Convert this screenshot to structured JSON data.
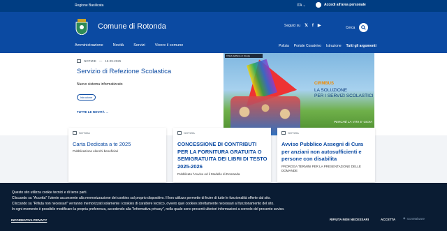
{
  "topbar": {
    "region": "Regione Basilicata",
    "language": "ITA",
    "login": "Accedi all'area personale"
  },
  "header": {
    "title": "Comune di Rotonda",
    "follow": "Seguici su",
    "social": [
      "twitter-icon",
      "facebook-icon",
      "youtube-icon"
    ],
    "search": "Cerca"
  },
  "nav": {
    "main": [
      "Amministrazione",
      "Novità",
      "Servizi",
      "Vivere il comune"
    ],
    "secondary": [
      "Polizia",
      "Portale Cosatvivo",
      "Istruzione",
      "Tutti gli argomenti"
    ]
  },
  "hero": {
    "category": "NOTIZIE",
    "date": "15-09-2025",
    "title": "Servizio di Refezione Scolastica",
    "subtitle": "Nuovo sistema informatizzato",
    "tag": "Istruzione",
    "all": "TUTTE LE NOVITÀ"
  },
  "promo": {
    "brand": "Il Web dell'Ente di Scuola",
    "highlight": "CIRMBUS",
    "line1": "LA SOLUZIONE",
    "line2": "PER I SERVIZI SCOLASTICI",
    "slogan": "PERCHÈ LA VITA E' GIOIA"
  },
  "cards": [
    {
      "category": "NOTIZIA",
      "title": "Carta Dedicata a te 2025",
      "desc": "Pubblicazione elenchi beneficiari"
    },
    {
      "category": "NOTIZIA",
      "title": "CONCESSIONE DI CONTRIBUTI PER LA FORNITURA GRATUITA O SEMIGRATUITA DEI LIBRI DI TESTO 2025-2026",
      "desc": "Pubblicato l'Avviso ed il Modello di Domanda"
    },
    {
      "category": "NOTIZIA",
      "title": "Avviso Pubblico Assegni di Cura per anziani non autosufficienti e persone con disabilita",
      "desc": "PROROGA TERMINI PER LA PRESENTAZIONE DELLE DOMANDE"
    }
  ],
  "cookie": {
    "lines": [
      "Questo sito utilizza cookie tecnici e di terze parti.",
      "Cliccando su \"Accetta\" l'utente acconsente alla memorizzazione dei cookies sul proprio dispositivo. Il loro utilizzo permette di fruire di tutte le funzionalità offerte dal sito.",
      "Cliccando su \"Rifiuta non necessari\" verranno memorizzati solamente i cookies di carattere tecnico, ovvero quei cookies strettamente necessari al funzionamento del sito.",
      "In ogni momento è possibile modificare la propria preferenza, accedendo alla \"Informativa privacy\", nella quale sono presenti ulteriori informazioni a corredo del presente avviso."
    ],
    "privacy": "INFORMATIVA PRIVACY",
    "reject": "RIFIUTA NON NECESSARI",
    "accept": "ACCETTA",
    "badge": "IconMalware"
  }
}
